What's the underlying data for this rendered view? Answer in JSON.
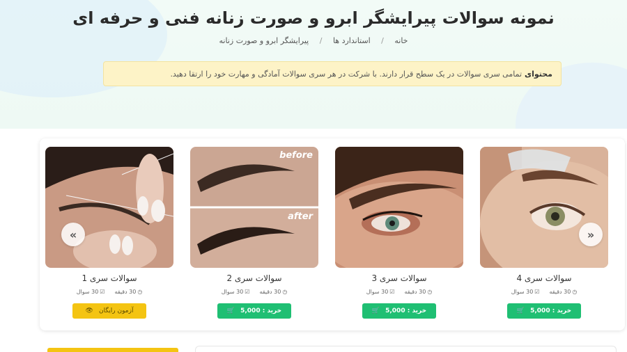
{
  "hero": {
    "title": "نمونه سوالات پیرایشگر ابرو و صورت زنانه فنی و حرفه ای",
    "breadcrumb": [
      "خانه",
      "استاندارد ها",
      "پیرایشگر ابرو و صورت زنانه"
    ]
  },
  "notice": {
    "label": "محتوای",
    "text": "تمامی سری سوالات در یک سطح قرار دارند. با شرکت در هر سری سوالات آمادگی و مهارت خود را ارتقا دهید."
  },
  "cards": [
    {
      "title": "سوالات سری 1",
      "duration": "30 دقیقه",
      "count": "30 سوال",
      "button": "آزمون رایگان",
      "button_type": "free",
      "button_icon": "eye-icon"
    },
    {
      "title": "سوالات سری 2",
      "duration": "30 دقیقه",
      "count": "30 سوال",
      "button": "خرید : 5,000",
      "button_type": "buy",
      "button_icon": "cart-icon",
      "image_text_before": "before",
      "image_text_after": "after"
    },
    {
      "title": "سوالات سری 3",
      "duration": "30 دقیقه",
      "count": "30 سوال",
      "button": "خرید : 5,000",
      "button_type": "buy",
      "button_icon": "cart-icon"
    },
    {
      "title": "سوالات سری 4",
      "duration": "30 دقیقه",
      "count": "30 سوال",
      "button": "خرید : 5,000",
      "button_type": "buy",
      "button_icon": "cart-icon"
    }
  ],
  "colors": {
    "green": "#1fbf73",
    "yellow": "#f4c412",
    "notice_bg": "#fdf3c7"
  }
}
